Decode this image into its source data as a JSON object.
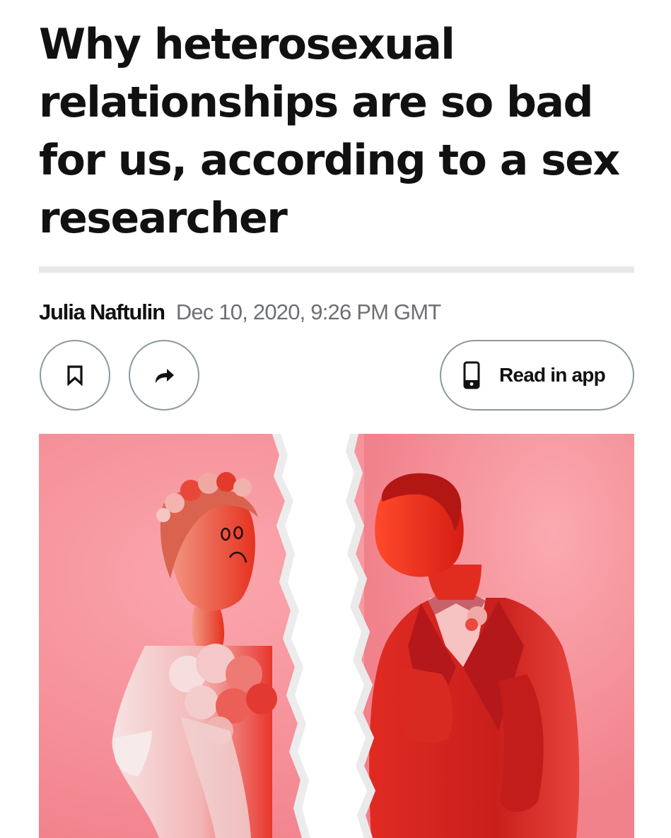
{
  "article": {
    "headline_lines": [
      "Why heterosexual",
      "relationships are so bad",
      "for us, according to a sex",
      "researcher"
    ],
    "author": "Julia Naftulin",
    "date": "Dec 10, 2020, 9:26 PM GMT"
  },
  "actions": {
    "bookmark_icon": "bookmark-icon",
    "share_icon": "share-arrow-icon",
    "read_in_app_icon": "phone-icon",
    "read_in_app_label": "Read in app"
  },
  "colors": {
    "text": "#111111",
    "muted_text": "#6d6f72",
    "button_border": "#8c989f",
    "divider": "#e6e8e9",
    "hero_background": "#f58f98",
    "figure_red": "#e8231c"
  }
}
